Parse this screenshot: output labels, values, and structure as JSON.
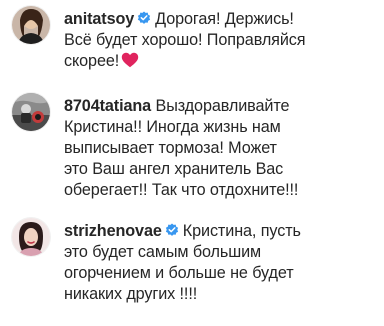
{
  "comments": [
    {
      "username": "anitatsoy",
      "verified": true,
      "lines": [
        "Дорогая! Держись!",
        "Всё будет хорошо! Поправляйся",
        "скорее!"
      ],
      "emoji": "red-heart"
    },
    {
      "username": "8704tatiana",
      "verified": false,
      "lines": [
        "Выздоравливайте",
        "Кристина!! Иногда жизнь нам",
        "выписывает тормоза! Может",
        "это Ваш ангел хранитель Вас",
        "оберегает!! Так что отдохните!!!"
      ]
    },
    {
      "username": "strizhenovae",
      "verified": true,
      "lines": [
        "Кристина, пусть",
        "это будет самым большим",
        "огорчением и больше не будет",
        "никаких других !!!!"
      ]
    }
  ],
  "colors": {
    "text": "#262626",
    "verified_badge": "#3897f0",
    "heart": "#e0245e"
  }
}
